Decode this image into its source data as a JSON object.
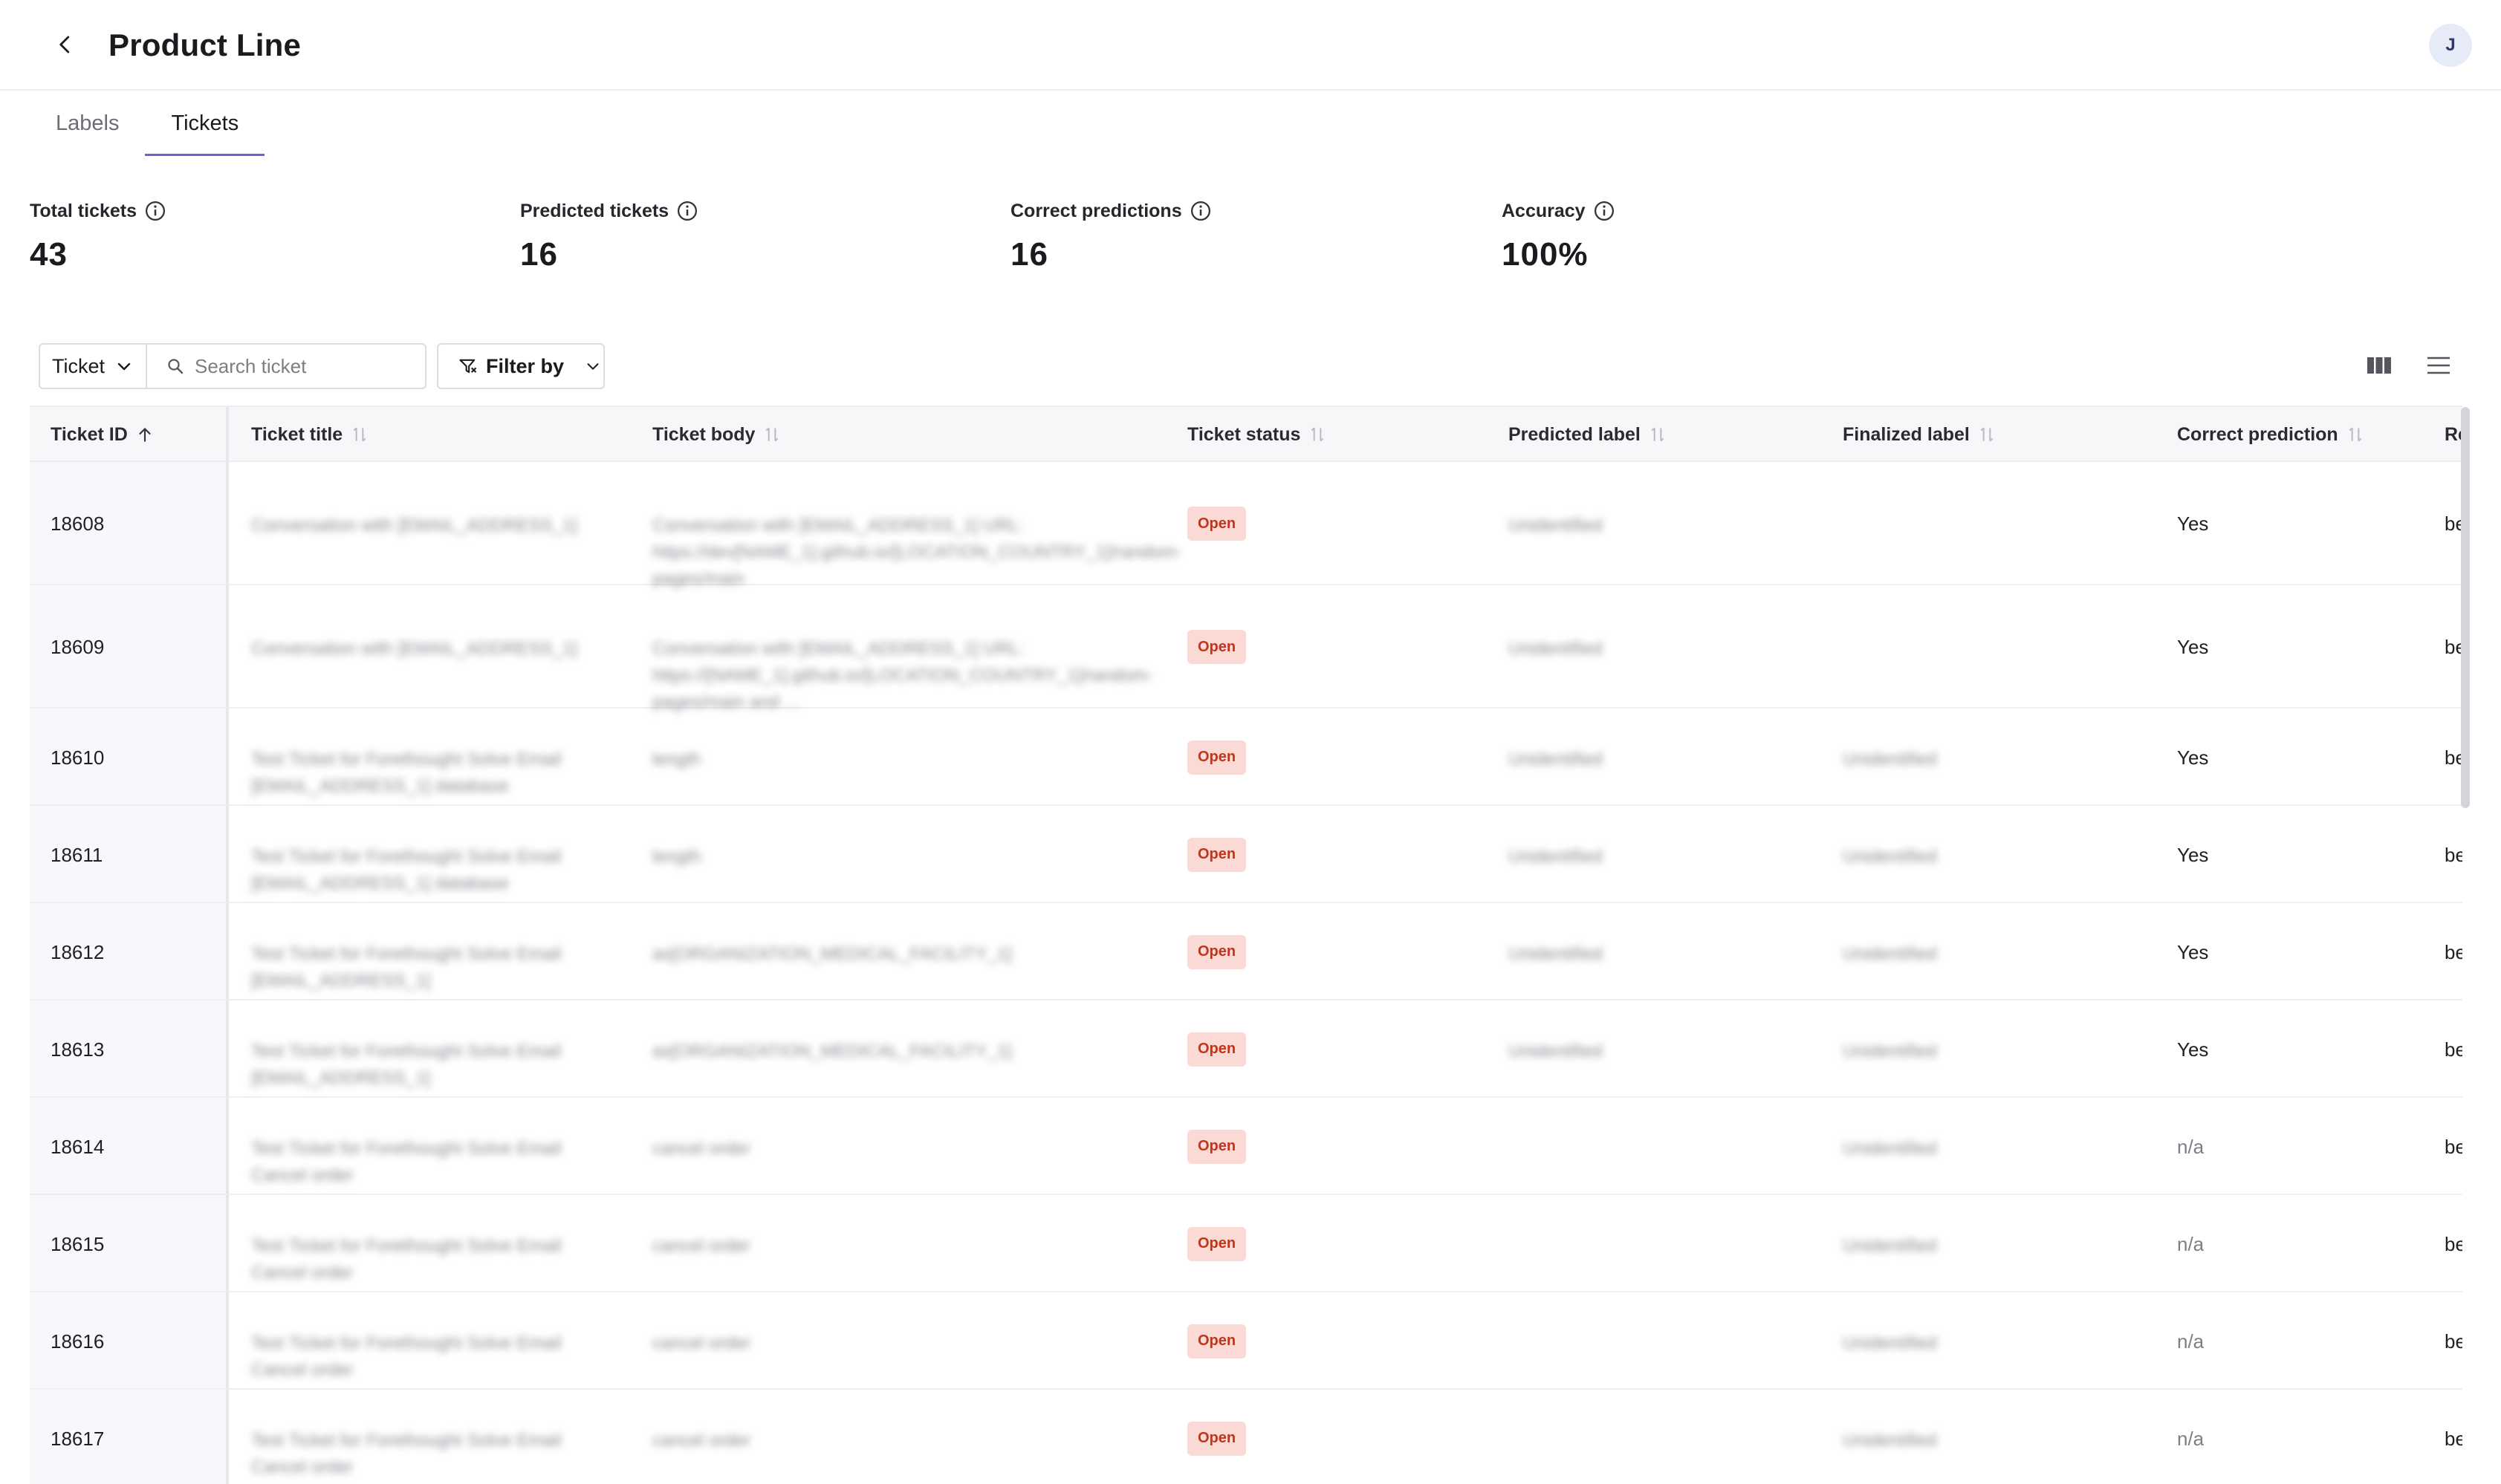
{
  "header": {
    "title": "Product Line",
    "avatar_initial": "J"
  },
  "tabs": [
    {
      "label": "Labels",
      "active": false
    },
    {
      "label": "Tickets",
      "active": true
    }
  ],
  "stats": [
    {
      "label": "Total tickets",
      "value": "43"
    },
    {
      "label": "Predicted tickets",
      "value": "16"
    },
    {
      "label": "Correct predictions",
      "value": "16"
    },
    {
      "label": "Accuracy",
      "value": "100%"
    }
  ],
  "toolbar": {
    "select_value": "Ticket",
    "search_placeholder": "Search ticket",
    "filter_label": "Filter by"
  },
  "table": {
    "columns": [
      "Ticket ID",
      "Ticket title",
      "Ticket body",
      "Ticket status",
      "Predicted label",
      "Finalized label",
      "Correct prediction",
      "Re"
    ],
    "rows": [
      {
        "id": "18608",
        "title": "Conversation with [EMAIL_ADDRESS_1]",
        "body": "Conversation with [EMAIL_ADDRESS_1] URL: https://dev[NAME_1].github.io/[LOCATION_COUNTRY_1]/random-pages/main",
        "status": "Open",
        "predicted": "Unidentified",
        "finalized": "",
        "correct": "Yes",
        "re": "be"
      },
      {
        "id": "18609",
        "title": "Conversation with [EMAIL_ADDRESS_1]",
        "body": "Conversation with [EMAIL_ADDRESS_1] URL: https://[NAME_1].github.io/[LOCATION_COUNTRY_1]/random-pages/main and ...",
        "status": "Open",
        "predicted": "Unidentified",
        "finalized": "",
        "correct": "Yes",
        "re": "be"
      },
      {
        "id": "18610",
        "title": "Test Ticket for Forethought Solve Email [EMAIL_ADDRESS_1] database",
        "body": "length",
        "status": "Open",
        "predicted": "Unidentified",
        "finalized": "Unidentified",
        "correct": "Yes",
        "re": "be"
      },
      {
        "id": "18611",
        "title": "Test Ticket for Forethought Solve Email [EMAIL_ADDRESS_1] database",
        "body": "length",
        "status": "Open",
        "predicted": "Unidentified",
        "finalized": "Unidentified",
        "correct": "Yes",
        "re": "be"
      },
      {
        "id": "18612",
        "title": "Test Ticket for Forethought Solve Email [EMAIL_ADDRESS_1]",
        "body": "as[ORGANIZATION_MEDICAL_FACILITY_1]",
        "status": "Open",
        "predicted": "Unidentified",
        "finalized": "Unidentified",
        "correct": "Yes",
        "re": "be"
      },
      {
        "id": "18613",
        "title": "Test Ticket for Forethought Solve Email [EMAIL_ADDRESS_1]",
        "body": "as[ORGANIZATION_MEDICAL_FACILITY_1]",
        "status": "Open",
        "predicted": "Unidentified",
        "finalized": "Unidentified",
        "correct": "Yes",
        "re": "be"
      },
      {
        "id": "18614",
        "title": "Test Ticket for Forethought Solve Email Cancel order",
        "body": "cancel order",
        "status": "Open",
        "predicted": "",
        "finalized": "Unidentified",
        "correct": "n/a",
        "re": "be"
      },
      {
        "id": "18615",
        "title": "Test Ticket for Forethought Solve Email Cancel order",
        "body": "cancel order",
        "status": "Open",
        "predicted": "",
        "finalized": "Unidentified",
        "correct": "n/a",
        "re": "be"
      },
      {
        "id": "18616",
        "title": "Test Ticket for Forethought Solve Email Cancel order",
        "body": "cancel order",
        "status": "Open",
        "predicted": "",
        "finalized": "Unidentified",
        "correct": "n/a",
        "re": "be"
      },
      {
        "id": "18617",
        "title": "Test Ticket for Forethought Solve Email Cancel order",
        "body": "cancel order",
        "status": "Open",
        "predicted": "",
        "finalized": "Unidentified",
        "correct": "n/a",
        "re": "be"
      }
    ]
  },
  "colors": {
    "accent": "#7a5ad8",
    "badge_bg": "#fbd9d4",
    "badge_text": "#c0361d"
  },
  "icons": {
    "back": "chevron-left-icon",
    "info": "info-icon",
    "search": "search-icon",
    "filter": "filter-icon",
    "columns": "columns-icon",
    "density": "menu-icon",
    "sort": "sort-icon",
    "sort_asc": "arrow-up-icon"
  }
}
